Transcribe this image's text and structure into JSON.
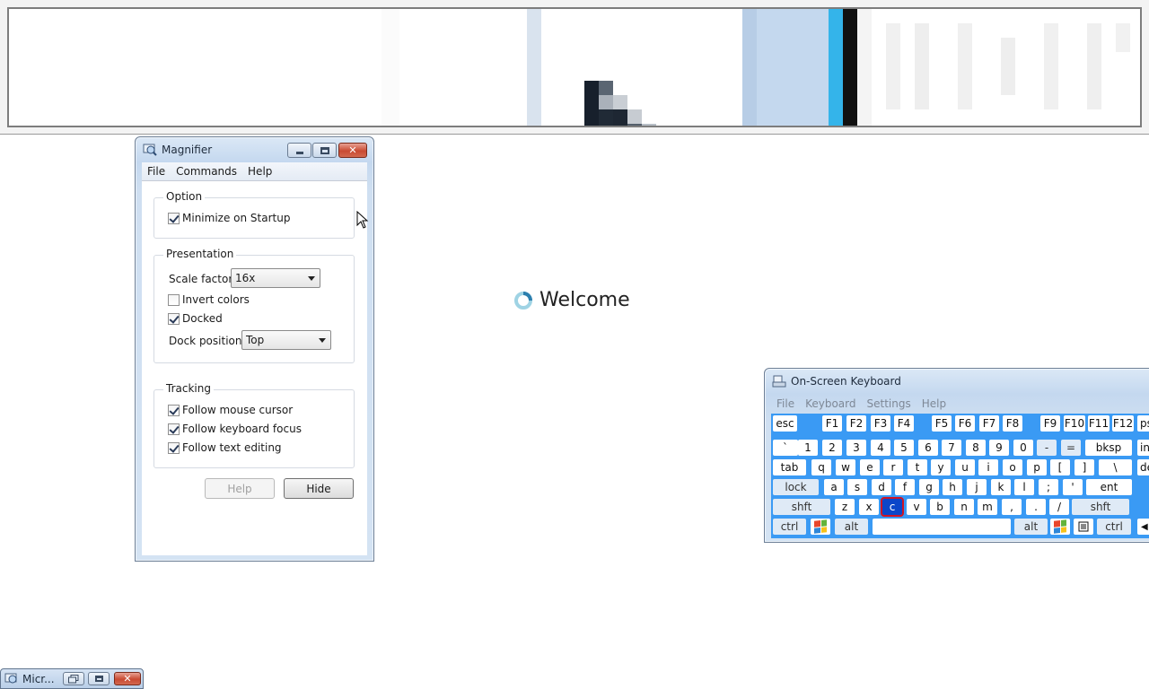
{
  "magnifier": {
    "title": "Magnifier",
    "menu": [
      "File",
      "Commands",
      "Help"
    ],
    "option_group": "Option",
    "minimize_on_startup": {
      "label": "Minimize on Startup",
      "checked": true
    },
    "presentation_group": "Presentation",
    "scale_factor_label": "Scale factor:",
    "scale_factor_value": "16x",
    "invert_colors": {
      "label": "Invert colors",
      "checked": false
    },
    "docked": {
      "label": "Docked",
      "checked": true
    },
    "dock_position_label": "Dock position:",
    "dock_position_value": "Top",
    "tracking_group": "Tracking",
    "follow_mouse": {
      "label": "Follow mouse cursor",
      "checked": true
    },
    "follow_keyboard": {
      "label": "Follow keyboard focus",
      "checked": true
    },
    "follow_text": {
      "label": "Follow text editing",
      "checked": true
    },
    "help_button": "Help",
    "hide_button": "Hide"
  },
  "welcome": {
    "text": "Welcome"
  },
  "osk": {
    "title": "On-Screen Keyboard",
    "menu": [
      "File",
      "Keyboard",
      "Settings",
      "Help"
    ],
    "rows": {
      "fn": [
        "esc",
        "F1",
        "F2",
        "F3",
        "F4",
        "F5",
        "F6",
        "F7",
        "F8",
        "F9",
        "F10",
        "F11",
        "F12",
        "ps"
      ],
      "num": [
        "`",
        "1",
        "2",
        "3",
        "4",
        "5",
        "6",
        "7",
        "8",
        "9",
        "0",
        "-",
        "=",
        "bksp",
        "ins"
      ],
      "tab": [
        "tab",
        "q",
        "w",
        "e",
        "r",
        "t",
        "y",
        "u",
        "i",
        "o",
        "p",
        "[",
        "]",
        "\\",
        "de"
      ],
      "caps": [
        "lock",
        "a",
        "s",
        "d",
        "f",
        "g",
        "h",
        "j",
        "k",
        "l",
        ";",
        "'",
        "ent"
      ],
      "shift": [
        "shft",
        "z",
        "x",
        "c",
        "v",
        "b",
        "n",
        "m",
        ",",
        ".",
        "/",
        "shft"
      ],
      "bottom": [
        "ctrl",
        "alt",
        "alt",
        "ctrl"
      ]
    },
    "selected_key": "c"
  },
  "taskbar": {
    "minimized_title": "Micr..."
  },
  "colors": {
    "keyboard_bg": "#3a9af4",
    "selected_key": "#0b46c9"
  }
}
